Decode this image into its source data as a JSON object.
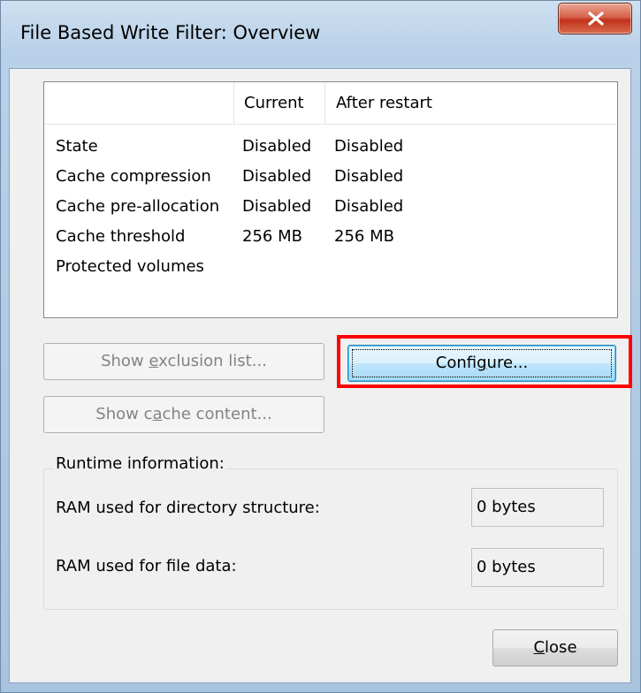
{
  "window": {
    "title": "File Based Write Filter: Overview",
    "accent_close": "#c1321a"
  },
  "status_table": {
    "columns": [
      "",
      "Current",
      "After restart"
    ],
    "rows": [
      {
        "label": "State",
        "current": "Disabled",
        "after_restart": "Disabled"
      },
      {
        "label": "Cache compression",
        "current": "Disabled",
        "after_restart": "Disabled"
      },
      {
        "label": "Cache pre-allocation",
        "current": "Disabled",
        "after_restart": "Disabled"
      },
      {
        "label": "Cache threshold",
        "current": "256 MB",
        "after_restart": "256 MB"
      },
      {
        "label": "Protected volumes",
        "current": "",
        "after_restart": ""
      }
    ]
  },
  "buttons": {
    "show_exclusion": {
      "before": "Show ",
      "mnemonic": "e",
      "after": "xclusion list...",
      "enabled": false
    },
    "configure": {
      "before": "Confi",
      "mnemonic": "g",
      "after": "ure...",
      "enabled": true
    },
    "show_cache": {
      "before": "Show c",
      "mnemonic": "a",
      "after": "che content...",
      "enabled": false
    },
    "close": {
      "before": "",
      "mnemonic": "C",
      "after": "lose",
      "enabled": true
    }
  },
  "runtime": {
    "group_label": "Runtime information:",
    "ram_dir_label": "RAM used for directory structure:",
    "ram_dir_value": "0 bytes",
    "ram_file_label": "RAM used for file data:",
    "ram_file_value": "0 bytes"
  },
  "highlight_color": "#ff0000"
}
